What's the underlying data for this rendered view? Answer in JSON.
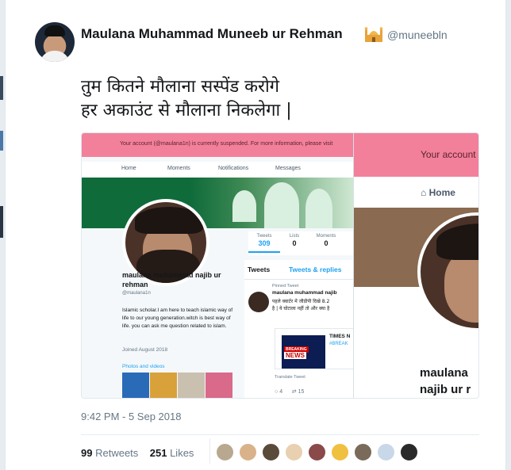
{
  "author": {
    "name": "Maulana Muhammad Muneeb ur Rehman",
    "handle": "@muneebln",
    "badge_icon": "mosque-icon"
  },
  "tweet": {
    "text_line1": "तुम कितने मौलाना सस्पेंड करोगे",
    "text_line2": "हर अकाउंट से मौलाना निकलेगा |",
    "timestamp": "9:42 PM - 5 Sep 2018",
    "retweets_count": "99",
    "retweets_label": "Retweets",
    "likes_count": "251",
    "likes_label": "Likes"
  },
  "media": {
    "banner_text": "Your account (@maulana1n) is currently suspended. For more information, please visit",
    "nav": [
      "Home",
      "Moments",
      "Notifications",
      "Messages"
    ],
    "stats": [
      {
        "label": "Tweets",
        "value": "309"
      },
      {
        "label": "Lists",
        "value": "0"
      },
      {
        "label": "Moments",
        "value": "0"
      }
    ],
    "profile_name": "maulana muhammad najib ur rehman",
    "profile_handle": "@maulana1n",
    "bio": "Islamic scholar.I am here to teach islamic way of life to our young generation.witch is best way of life. you can ask me question related to islam.",
    "joined": "Joined August 2018",
    "photos_label": "Photos and videos",
    "tab_tweets": "Tweets",
    "tab_replies": "Tweets & replies",
    "pinned_label": "Pinned Tweet",
    "feed_name": "maulana muhammad najib",
    "feed_text": "पहले क्वार्टर में जीडीपी दिखे 8.2\nहै | ये घोटाला नहीं तो और क्या है",
    "breaking_label": "BREAKING",
    "news_label": "NEWS",
    "card_title": "TIMES N",
    "card_tag": "#BREAK",
    "translate_label": "Translate Tweet",
    "reply_count": "4",
    "retweet_count": "15",
    "zoom_banner_text": "Your account",
    "zoom_home": "Home",
    "zoom_name": "maulana najib ur r"
  },
  "colors": {
    "banner": "#f3809a",
    "link": "#1da1f2",
    "muted": "#657786"
  }
}
